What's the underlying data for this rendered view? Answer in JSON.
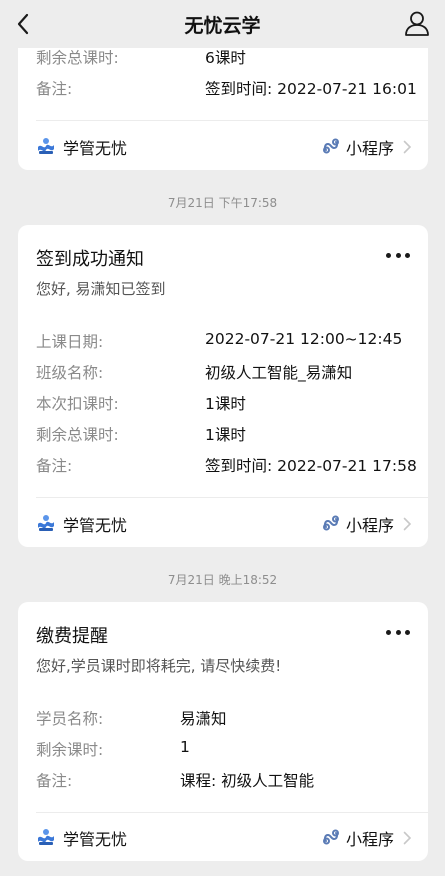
{
  "nav": {
    "title": "无忧云学"
  },
  "colors": {
    "brand_icon": "#3b78d8",
    "link_icon": "#5a7bb5"
  },
  "card1": {
    "rows": [
      {
        "key": "剩余总课时:",
        "value": "6课时"
      },
      {
        "key": "备注:",
        "value": "签到时间: 2022-07-21 16:01"
      }
    ],
    "footer": {
      "brand": "学管无忧",
      "mini_program": "小程序"
    }
  },
  "timestamps": [
    "7月21日 下午17:58",
    "7月21日 晚上18:52"
  ],
  "card2": {
    "title": "签到成功通知",
    "subtitle": "您好, 易潇知已签到",
    "rows": [
      {
        "key": "上课日期:",
        "value": "2022-07-21 12:00~12:45"
      },
      {
        "key": "班级名称:",
        "value": "初级人工智能_易潇知"
      },
      {
        "key": "本次扣课时:",
        "value": "1课时"
      },
      {
        "key": "剩余总课时:",
        "value": "1课时"
      },
      {
        "key": "备注:",
        "value": "签到时间: 2022-07-21 17:58"
      }
    ],
    "footer": {
      "brand": "学管无忧",
      "mini_program": "小程序"
    }
  },
  "card3": {
    "title": "缴费提醒",
    "subtitle": "您好,学员课时即将耗完, 请尽快续费!",
    "rows": [
      {
        "key": "学员名称:",
        "value": "易潇知"
      },
      {
        "key": "剩余课时:",
        "value": "1"
      },
      {
        "key": "备注:",
        "value": "课程: 初级人工智能"
      }
    ],
    "footer": {
      "brand": "学管无忧",
      "mini_program": "小程序"
    }
  }
}
